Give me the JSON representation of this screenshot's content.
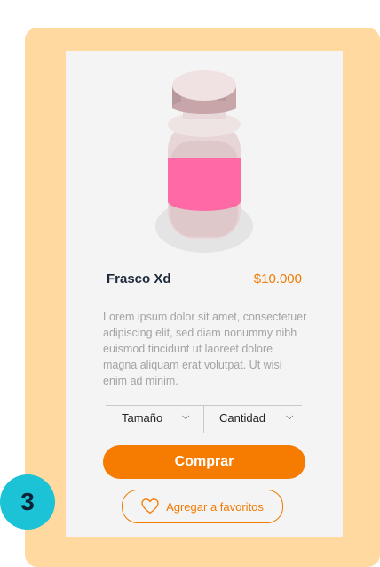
{
  "product": {
    "name": "Frasco Xd",
    "price": "$10.000",
    "description": "Lorem ipsum dolor sit amet, consectetuer adipiscing elit, sed diam nonummy nibh euismod tincidunt ut laoreet dolore magna aliquam erat volutpat. Ut wisi enim ad minim.",
    "image_icon": "jar-icon"
  },
  "selectors": {
    "size_label": "Tamaño",
    "quantity_label": "Cantidad"
  },
  "actions": {
    "buy_label": "Comprar",
    "favorite_label": "Agregar a favoritos",
    "favorite_icon": "heart-icon"
  },
  "step": {
    "number": "3"
  },
  "colors": {
    "frame": "#ffd9a0",
    "accent": "#f57c00",
    "badge": "#1cc2d6",
    "card": "#f4f4f4"
  }
}
